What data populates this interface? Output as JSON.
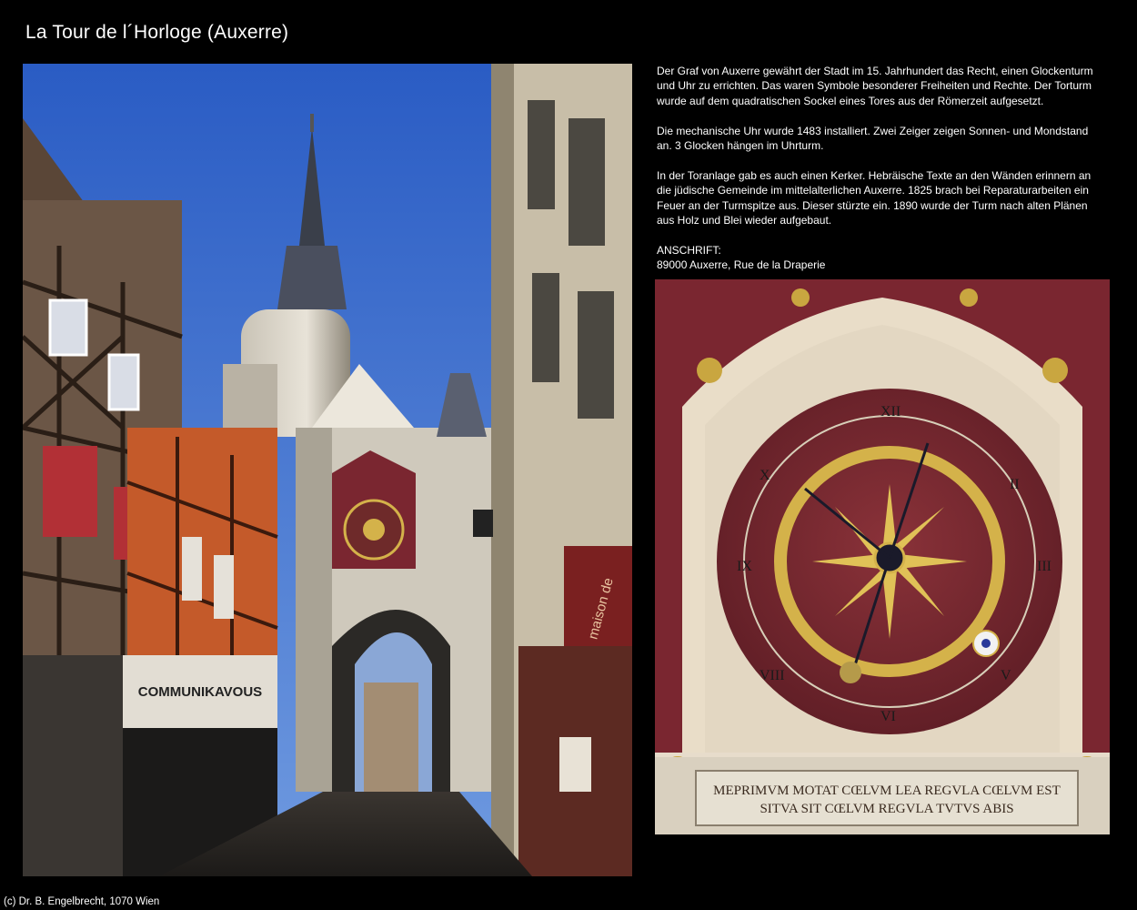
{
  "page": {
    "title": "La Tour de l´Horloge (Auxerre)",
    "footer": "(c) Dr. B. Engelbrecht, 1070 Wien"
  },
  "description": {
    "paragraphs": [
      "Der Graf von Auxerre gewährt der Stadt im 15. Jahrhundert das Recht, einen Glockenturm und Uhr zu errichten. Das waren Symbole besonderer Freiheiten und Rechte. Der Torturm wurde auf dem quadratischen Sockel eines Tores aus der Römerzeit aufgesetzt.",
      "Die mechanische Uhr wurde 1483 installiert. Zwei Zeiger zeigen Sonnen- und Mondstand an. 3 Glocken hängen im Uhrturm.",
      "In der Toranlage gab es auch einen Kerker. Hebräische Texte an den Wänden erinnern an die jüdische Gemeinde im mittelalterlichen Auxerre. 1825 brach bei Reparaturarbeiten ein Feuer an der Turmspitze aus. Dieser stürzte ein. 1890 wurde der Turm nach alten Plänen aus Holz und Blei wieder aufgebaut."
    ],
    "address_label": "ANSCHRIFT:",
    "address": "89000 Auxerre, Rue de la Draperie"
  },
  "photo_street": {
    "sign_shop": "COMMUNIKAVOUS",
    "sign_maison": "maison de"
  },
  "photo_clock": {
    "inscription_line1": "MEPRIMVM MOTAT CŒLVM LEA REGVLA CŒLVM EST",
    "inscription_line2": "SITVA SIT CŒLVM REGVLA TVTVS ABIS"
  },
  "colors": {
    "background": "#000000",
    "sky": "#2f63c9",
    "clock_red": "#7a2630",
    "gold": "#d4b24a"
  }
}
